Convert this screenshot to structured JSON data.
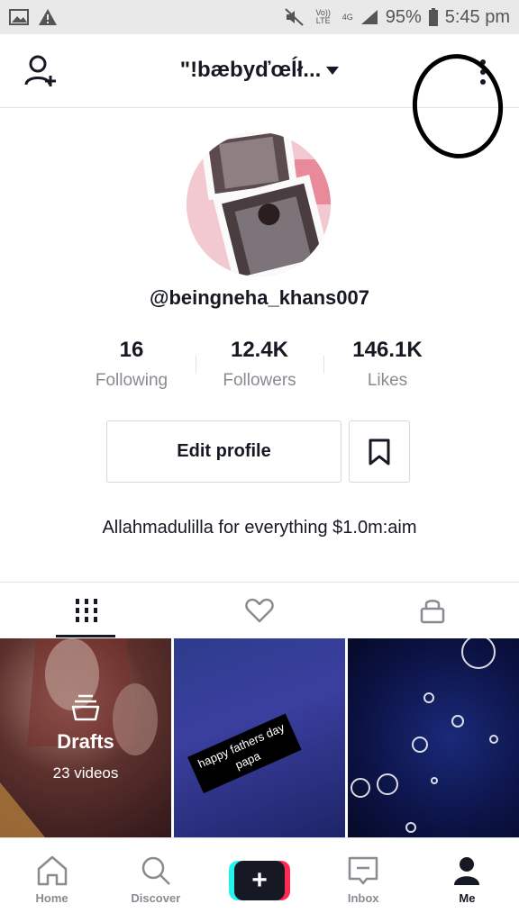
{
  "status_bar": {
    "network_volte": "Vo)) LTE",
    "network_4g": "4G",
    "battery": "95%",
    "time": "5:45 pm"
  },
  "header": {
    "title": "\"!bæbyďœĺł...",
    "icons": {
      "left": "add-user-icon",
      "right": "more-vertical-icon"
    }
  },
  "profile": {
    "username": "@beingneha_khans007",
    "stats": [
      {
        "value": "16",
        "label": "Following"
      },
      {
        "value": "12.4K",
        "label": "Followers"
      },
      {
        "value": "146.1K",
        "label": "Likes"
      }
    ],
    "edit_label": "Edit profile",
    "bio": "Allahmadulilla for everything $1.0m:aim"
  },
  "tabs": [
    {
      "icon": "grid-icon",
      "active": true
    },
    {
      "icon": "heart-icon",
      "active": false
    },
    {
      "icon": "lock-icon",
      "active": false
    }
  ],
  "grid": {
    "drafts_label": "Drafts",
    "drafts_count": "23 videos",
    "caption_line1": "happy fathers day",
    "caption_line2": "papa"
  },
  "bottom_nav": [
    {
      "label": "Home",
      "icon": "home-icon",
      "active": false
    },
    {
      "label": "Discover",
      "icon": "search-icon",
      "active": false
    },
    {
      "label": "",
      "icon": "plus-icon",
      "active": false
    },
    {
      "label": "Inbox",
      "icon": "inbox-icon",
      "active": false
    },
    {
      "label": "Me",
      "icon": "person-icon",
      "active": true
    }
  ],
  "colors": {
    "accent_cyan": "#25f4ee",
    "accent_red": "#fe2c55",
    "text": "#161823",
    "muted": "#8a8b91"
  }
}
